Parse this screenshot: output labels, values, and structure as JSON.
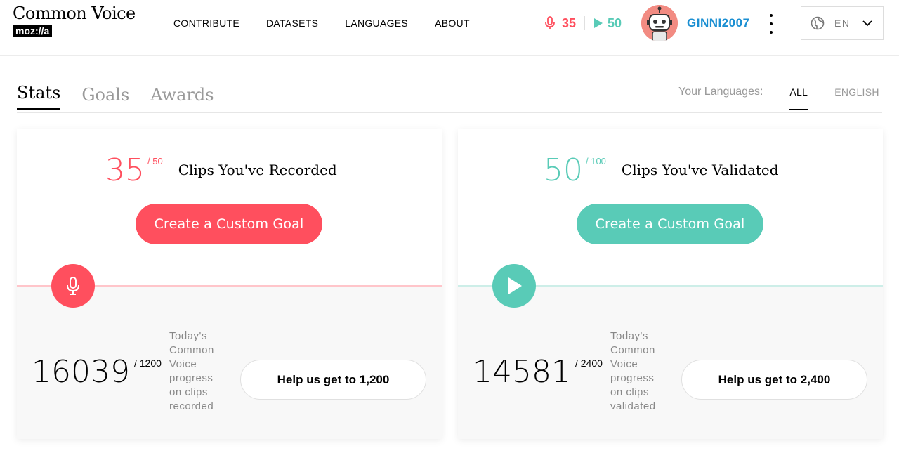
{
  "app": {
    "title": "Common Voice",
    "brand": "moz://a"
  },
  "nav": {
    "items": [
      "CONTRIBUTE",
      "DATASETS",
      "LANGUAGES",
      "ABOUT"
    ]
  },
  "user": {
    "recorded_count": "35",
    "validated_count": "50",
    "username": "GINNI2007",
    "language_code": "EN"
  },
  "tabs": {
    "items": [
      "Stats",
      "Goals",
      "Awards"
    ],
    "active": "Stats"
  },
  "language_filter": {
    "label": "Your Languages:",
    "options": [
      "ALL",
      "ENGLISH"
    ],
    "active": "ALL"
  },
  "cards": [
    {
      "goal_value": "35",
      "goal_target": "/ 50",
      "goal_label": "Clips You've Recorded",
      "button_label": "Create a Custom Goal",
      "accent": "#ff4f5e",
      "icon": "microphone-icon",
      "daily_value": "16039",
      "daily_target": "/ 1200",
      "progress_text": "Today's Common Voice progress on clips recorded",
      "help_label": "Help us get to 1,200"
    },
    {
      "goal_value": "50",
      "goal_target": "/ 100",
      "goal_label": "Clips You've Validated",
      "button_label": "Create a Custom Goal",
      "accent": "#59cbb7",
      "icon": "play-icon",
      "daily_value": "14581",
      "daily_target": "/ 2400",
      "progress_text": "Today's Common Voice progress on clips validated",
      "help_label": "Help us get to 2,400"
    }
  ],
  "colors": {
    "record": "#ff4f5e",
    "validate": "#59cbb7",
    "username": "#1b8fd2"
  }
}
